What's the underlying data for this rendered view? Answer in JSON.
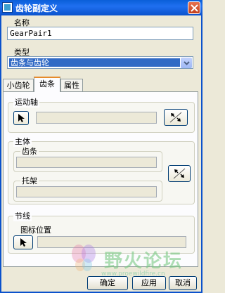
{
  "window": {
    "title": "齿轮副定义",
    "title_bar_color": "#0b52cc"
  },
  "form": {
    "name_label": "名称",
    "name_value": "GearPair1",
    "type_label": "类型",
    "type_value": "齿条与齿轮"
  },
  "tabs": [
    {
      "label": "小齿轮"
    },
    {
      "label": "齿条"
    },
    {
      "label": "属性"
    }
  ],
  "active_tab": "齿条",
  "panel": {
    "motion_axis": {
      "title": "运动轴"
    },
    "body": {
      "title": "主体",
      "rack_label": "齿条",
      "carrier_label": "托架"
    },
    "pitch_line": {
      "title": "节线",
      "icon_pos_label": "图标位置"
    }
  },
  "buttons": {
    "ok": "确定",
    "apply": "应用",
    "cancel": "取消"
  },
  "watermark": {
    "text": "野火论坛",
    "sub": "www.proewildfire.cn"
  }
}
